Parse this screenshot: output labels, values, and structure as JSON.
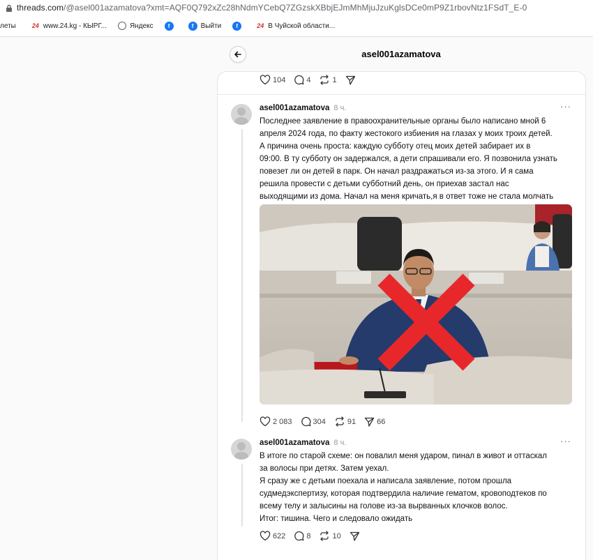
{
  "browser": {
    "url_host": "threads.com",
    "url_path": "/@asel001azamatova?xmt=AQF0Q792xZc28hNdmYCebQ7ZGzskXBbjEJmMhMjuJzuKglsDCe0mP9Z1rbovNtz1FSdT_E-0",
    "bookmarks": [
      {
        "label": "леты",
        "icon": "none"
      },
      {
        "label": "www.24.kg - КЫРГ...",
        "icon": "24kg-logo"
      },
      {
        "label": "Яндекс",
        "icon": "globe-icon"
      },
      {
        "label": "",
        "icon": "facebook-icon"
      },
      {
        "label": "Выйти",
        "icon": "facebook-icon"
      },
      {
        "label": "",
        "icon": "facebook-icon"
      },
      {
        "label": "В Чуйской области...",
        "icon": "24kg-logo"
      }
    ]
  },
  "header": {
    "title": "asel001azamatova"
  },
  "top_post_actions": {
    "likes": "104",
    "replies": "4",
    "reposts": "1"
  },
  "posts": [
    {
      "username": "asel001azamatova",
      "time": "8 ч.",
      "text": "Последнее заявление в правоохранительные органы было написано мной 6\nапреля 2024 года, по факту жестокого избиения на глазах у моих троих детей.\nА причина очень проста: каждую субботу отец моих детей забирает их в\n09:00. В ту субботу он задержался, а дети спрашивали его. Я позвонила узнать\nповезет ли он детей в парк. Он начал раздражаться из-за этого. И я сама\nрешила провести с детьми субботний день, он приехав застал нас\nвыходящими из дома. Начал на меня кричать,я в ответ тоже не стала молчать",
      "likes": "2 083",
      "replies": "304",
      "reposts": "91",
      "shares": "66"
    },
    {
      "username": "asel001azamatova",
      "time": "8 ч.",
      "text": "В итоге по старой схеме: он повалил меня ударом, пинал в живот и оттаскал\nза волосы при детях. Затем уехал.\nЯ сразу же с детьми поехала и написала заявление, потом прошла\nсудмедэкспертизу, которая подтвердила наличие гематом, кровоподтеков по\nвсему телу и залысины на голове из-за вырванных клочков волос.\nИтог: тишина. Чего и следовало ожидать",
      "likes": "622",
      "replies": "8",
      "reposts": "10"
    }
  ],
  "colors": {
    "cross": "#e8272b",
    "suit": "#243b6b"
  }
}
